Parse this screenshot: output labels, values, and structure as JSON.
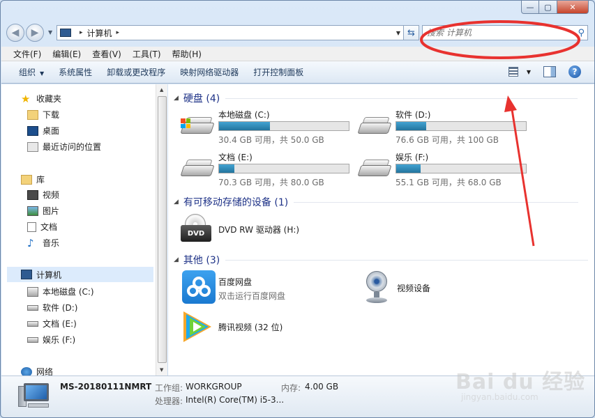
{
  "window": {
    "caption_buttons": {
      "minimize": "—",
      "maximize": "▢",
      "close": "✕"
    }
  },
  "address_bar": {
    "path_root_sep": "▸",
    "path": "计算机",
    "path_end_sep": "▸",
    "search_placeholder": "搜索 计算机"
  },
  "menu": [
    "文件(F)",
    "编辑(E)",
    "查看(V)",
    "工具(T)",
    "帮助(H)"
  ],
  "toolbar": {
    "organize": "组织",
    "system_props": "系统属性",
    "uninstall": "卸载或更改程序",
    "map_drive": "映射网络驱动器",
    "control_panel": "打开控制面板"
  },
  "navigation": {
    "favorites": "收藏夹",
    "downloads": "下载",
    "desktop": "桌面",
    "recent": "最近访问的位置",
    "libraries": "库",
    "videos": "视频",
    "pictures": "图片",
    "documents": "文档",
    "music": "音乐",
    "computer": "计算机",
    "drive_c": "本地磁盘 (C:)",
    "drive_d": "软件 (D:)",
    "drive_e": "文档 (E:)",
    "drive_f": "娱乐 (F:)",
    "network": "网络"
  },
  "groups": {
    "hdd": "硬盘 (4)",
    "removable": "有可移动存储的设备 (1)",
    "other": "其他 (3)"
  },
  "drives": [
    {
      "name": "本地磁盘 (C:)",
      "info": "30.4 GB 可用，共 50.0 GB",
      "used_fraction": 0.39
    },
    {
      "name": "软件 (D:)",
      "info": "76.6 GB 可用，共 100 GB",
      "used_fraction": 0.23
    },
    {
      "name": "文档 (E:)",
      "info": "70.3 GB 可用，共 80.0 GB",
      "used_fraction": 0.12
    },
    {
      "name": "娱乐 (F:)",
      "info": "55.1 GB 可用，共 68.0 GB",
      "used_fraction": 0.19
    }
  ],
  "dvd": {
    "label": "DVD RW 驱动器 (H:)",
    "badge": "DVD"
  },
  "other_items": {
    "baidu_name": "百度网盘",
    "baidu_desc": "双击运行百度网盘",
    "webcam": "视频设备",
    "tencent": "腾讯视频 (32 位)"
  },
  "details": {
    "pc_name": "MS-20180111NMRT",
    "workgroup_label": "工作组:",
    "workgroup": "WORKGROUP",
    "memory_label": "内存:",
    "memory": "4.00 GB",
    "cpu_label": "处理器:",
    "cpu": "Intel(R) Core(TM) i5-3..."
  },
  "watermark": {
    "brand": "Bai du 经验",
    "url": "jingyan.baidu.com"
  },
  "colors": {
    "accent": "#1e3287",
    "annotation_red": "#e8322f",
    "drive_fill": "#2a86b6"
  }
}
